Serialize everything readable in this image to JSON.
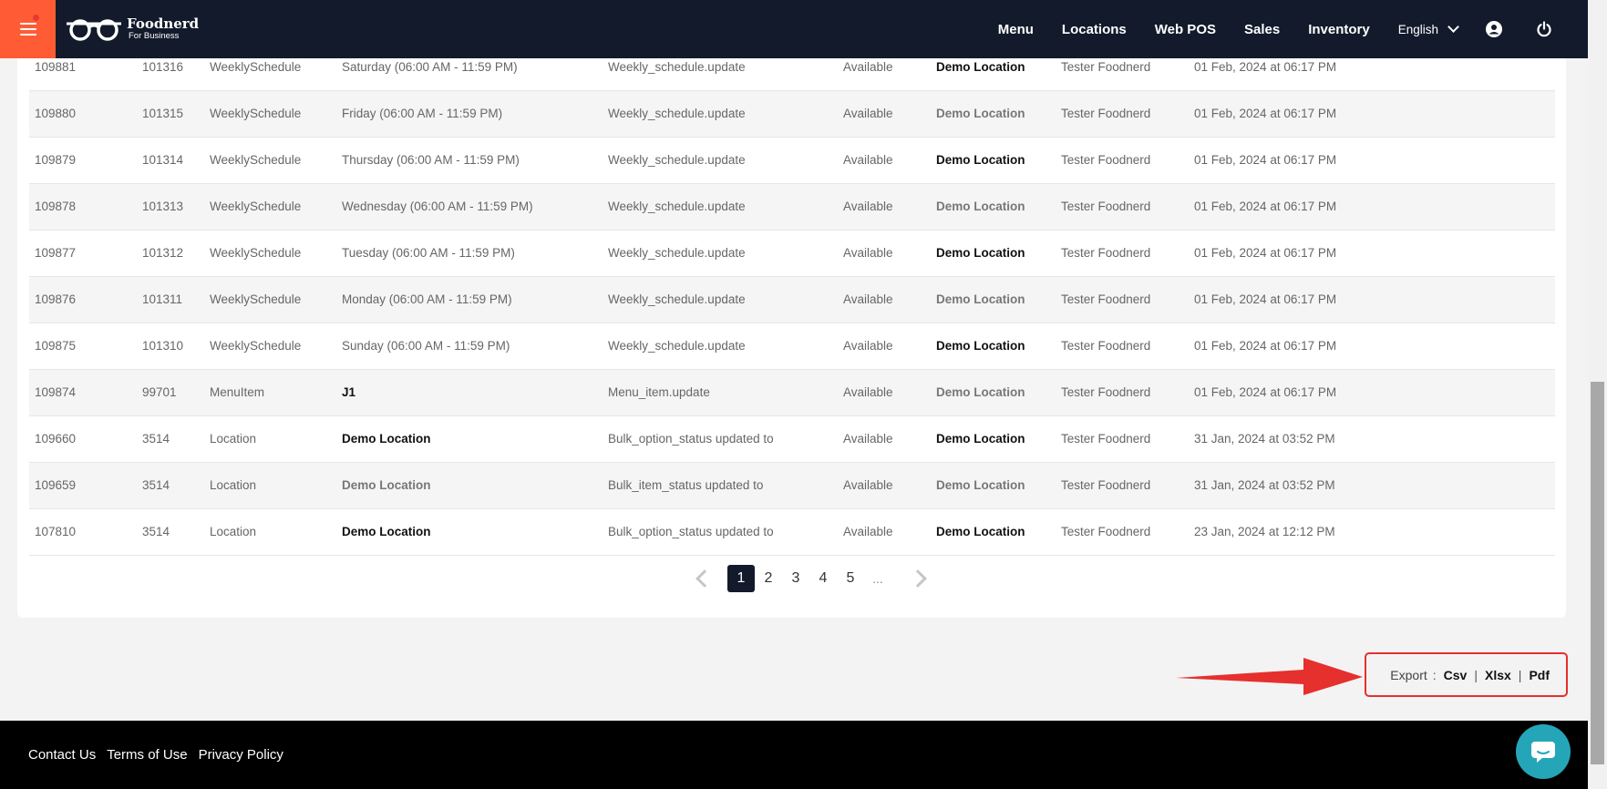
{
  "header": {
    "logo_title": "Foodnerd",
    "logo_subtitle": "For Business",
    "nav": [
      "Menu",
      "Locations",
      "Web POS",
      "Sales",
      "Inventory"
    ],
    "language": "English"
  },
  "rows": [
    [
      "109881",
      "101316",
      "WeeklySchedule",
      "Saturday (06:00 AM - 11:59 PM)",
      "Weekly_schedule.update",
      "Available",
      "Demo Location",
      "Tester Foodnerd",
      "01 Feb, 2024 at 06:17 PM"
    ],
    [
      "109880",
      "101315",
      "WeeklySchedule",
      "Friday (06:00 AM - 11:59 PM)",
      "Weekly_schedule.update",
      "Available",
      "Demo Location",
      "Tester Foodnerd",
      "01 Feb, 2024 at 06:17 PM"
    ],
    [
      "109879",
      "101314",
      "WeeklySchedule",
      "Thursday (06:00 AM - 11:59 PM)",
      "Weekly_schedule.update",
      "Available",
      "Demo Location",
      "Tester Foodnerd",
      "01 Feb, 2024 at 06:17 PM"
    ],
    [
      "109878",
      "101313",
      "WeeklySchedule",
      "Wednesday (06:00 AM - 11:59 PM)",
      "Weekly_schedule.update",
      "Available",
      "Demo Location",
      "Tester Foodnerd",
      "01 Feb, 2024 at 06:17 PM"
    ],
    [
      "109877",
      "101312",
      "WeeklySchedule",
      "Tuesday (06:00 AM - 11:59 PM)",
      "Weekly_schedule.update",
      "Available",
      "Demo Location",
      "Tester Foodnerd",
      "01 Feb, 2024 at 06:17 PM"
    ],
    [
      "109876",
      "101311",
      "WeeklySchedule",
      "Monday (06:00 AM - 11:59 PM)",
      "Weekly_schedule.update",
      "Available",
      "Demo Location",
      "Tester Foodnerd",
      "01 Feb, 2024 at 06:17 PM"
    ],
    [
      "109875",
      "101310",
      "WeeklySchedule",
      "Sunday (06:00 AM - 11:59 PM)",
      "Weekly_schedule.update",
      "Available",
      "Demo Location",
      "Tester Foodnerd",
      "01 Feb, 2024 at 06:17 PM"
    ],
    [
      "109874",
      "99701",
      "MenuItem",
      "J1",
      "Menu_item.update",
      "Available",
      "Demo Location",
      "Tester Foodnerd",
      "01 Feb, 2024 at 06:17 PM"
    ],
    [
      "109660",
      "3514",
      "Location",
      "Demo Location",
      "Bulk_option_status updated to",
      "Available",
      "Demo Location",
      "Tester Foodnerd",
      "31 Jan, 2024 at 03:52 PM"
    ],
    [
      "109659",
      "3514",
      "Location",
      "Demo Location",
      "Bulk_item_status updated to",
      "Available",
      "Demo Location",
      "Tester Foodnerd",
      "31 Jan, 2024 at 03:52 PM"
    ],
    [
      "107810",
      "3514",
      "Location",
      "Demo Location",
      "Bulk_option_status updated to",
      "Available",
      "Demo Location",
      "Tester Foodnerd",
      "23 Jan, 2024 at 12:12 PM"
    ]
  ],
  "pagination": {
    "pages": [
      "1",
      "2",
      "3",
      "4",
      "5"
    ],
    "active": "1",
    "ellipsis": "..."
  },
  "export": {
    "label": "Export",
    "separator": ":",
    "pipe": "|",
    "csv": "Csv",
    "xlsx": "Xlsx",
    "pdf": "Pdf"
  },
  "footer": {
    "links": [
      "Contact Us",
      "Terms of Use",
      "Privacy Policy"
    ]
  },
  "colors": {
    "header_bg": "#121a2b",
    "menu_button": "#ff5c35",
    "highlight": "#e5302e",
    "chat": "#25a6b8"
  }
}
